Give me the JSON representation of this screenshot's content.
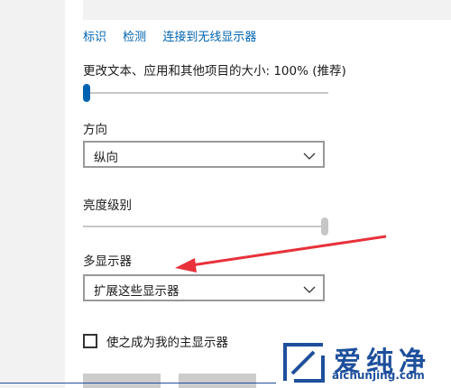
{
  "links": [
    "标识",
    "检测",
    "连接到无线显示器"
  ],
  "scale": {
    "label": "更改文本、应用和其他项目的大小: 100% (推荐)",
    "value_fraction": 0.0
  },
  "orientation": {
    "label": "方向",
    "value": "纵向"
  },
  "brightness": {
    "label": "亮度级别",
    "value_fraction": 1.0
  },
  "multi_display": {
    "label": "多显示器",
    "value": "扩展这些显示器"
  },
  "main_display_checkbox": {
    "label": "使之成为我的主显示器",
    "checked": false
  },
  "watermark": {
    "name": "爱纯净",
    "url": "aichunjing.com"
  },
  "colors": {
    "accent": "#0063b1",
    "arrow": "#e8313a",
    "watermark": "#1e4f9c"
  },
  "icons": [
    "chevron-down-icon",
    "watermark-logo-icon"
  ]
}
